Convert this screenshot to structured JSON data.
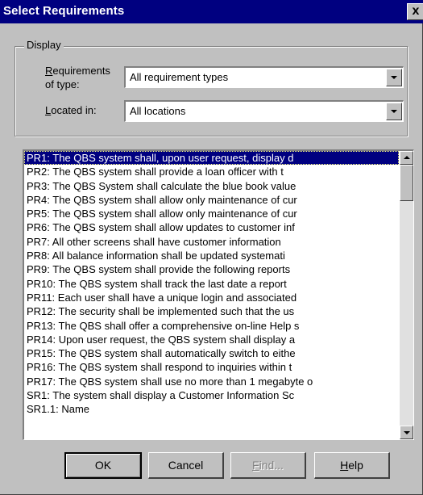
{
  "window": {
    "title": "Select Requirements",
    "close_glyph": "x"
  },
  "display_group": {
    "legend": "Display",
    "requirements_label_line1_accel": "R",
    "requirements_label_line1_rest": "equirements",
    "requirements_label_line2": "of type:",
    "requirements_value": "All requirement types",
    "located_label_accel": "L",
    "located_label_rest": "ocated in:",
    "located_value": "All locations"
  },
  "requirements_list": {
    "items": [
      "PR1: The QBS system shall, upon user request, display d",
      "PR2: The QBS system shall provide a loan officer with t",
      "PR3: The QBS System shall calculate the blue book value",
      "PR4: The QBS system shall allow only maintenance of cur",
      "PR5: The QBS system shall allow only maintenance of cur",
      "PR6: The QBS system shall allow updates to customer inf",
      "PR7: All other screens shall have customer information",
      "PR8: All balance information shall be updated systemati",
      "PR9: The QBS system shall provide the following reports",
      "PR10: The QBS system shall track the last date a report",
      "PR11: Each user shall have a unique login and associated",
      "PR12: The security shall be implemented such that the us",
      "PR13: The QBS shall offer a comprehensive on-line Help s",
      "PR14: Upon user request, the QBS system shall display a",
      "PR15: The QBS system shall automatically switch to eithe",
      "PR16: The QBS system shall respond to inquiries within t",
      "PR17: The QBS system shall use no more than 1 megabyte o",
      "SR1: The system shall display a Customer Information Sc",
      "SR1.1: Name"
    ],
    "selected_index": 0
  },
  "buttons": {
    "ok": "OK",
    "cancel": "Cancel",
    "find_accel": "F",
    "find_rest": "ind...",
    "help_accel": "H",
    "help_rest": "elp"
  }
}
